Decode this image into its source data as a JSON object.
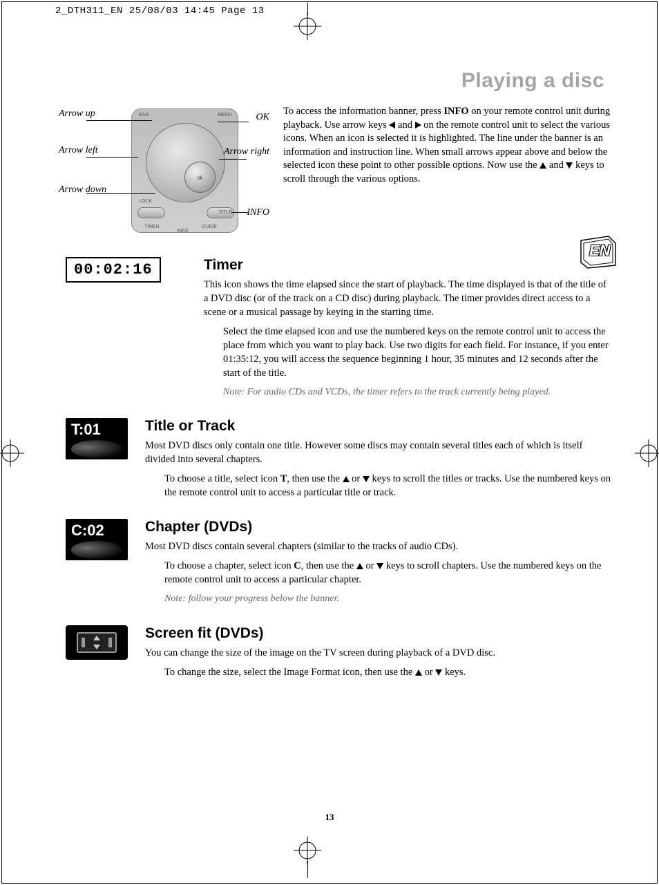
{
  "meta": {
    "header": "2_DTH311_EN  25/08/03  14:45  Page 13",
    "page_number": "13",
    "lang_badge": "EN"
  },
  "chapter_title": "Playing a disc",
  "remote": {
    "arrow_up": "Arrow up",
    "arrow_left": "Arrow left",
    "arrow_down": "Arrow down",
    "arrow_right": "Arrow right",
    "ok": "OK",
    "info": "INFO",
    "ok_btn": "ok",
    "btn_clear": "EAR",
    "btn_menu": "MENU",
    "btn_lock": "LOCK",
    "btn_title": "TITLE",
    "btn_timer": "TIMER",
    "btn_guide": "GUIDE",
    "btn_info": "INFO"
  },
  "intro": {
    "p1a": "To access the information banner, press ",
    "info_bold": "INFO",
    "p1b": " on your remote control unit during playback. Use arrow keys ",
    "p1c": " and ",
    "p1d": " on the remote control unit to select the various icons. When an icon is selected it is highlighted. The line under the banner is an information and instruction line. When small arrows appear above and below the selected icon these point to other possible options. Now use the ",
    "p1e": " and ",
    "p1f": " keys to scroll through the various options."
  },
  "timer": {
    "display": "00:02:16",
    "heading": "Timer",
    "p1": "This icon shows the time elapsed since the start of playback. The time displayed is that of the title of a DVD disc (or of the track on a CD disc) during playback. The timer provides direct access to a scene or a musical passage by keying in the starting time.",
    "p2": "Select the time elapsed icon and use the numbered keys on the remote control unit to access the place from which you want to play back. Use two digits for each field. For instance, if you enter 01:35:12, you will access the sequence beginning 1 hour, 35 minutes and 12 seconds after the start of the title.",
    "note": "Note: For audio CDs and VCDs, the timer refers to the track currently being played."
  },
  "title": {
    "icon_label": "T:01",
    "heading": "Title or Track",
    "p1": "Most DVD discs only contain one title. However some discs may contain several titles each of which is itself divided into several chapters.",
    "p2a": "To choose a title, select icon ",
    "t_bold": "T",
    "p2b": ", then use the ",
    "p2c": " or ",
    "p2d": " keys to scroll the titles or tracks. Use the numbered keys on the remote control unit to access a particular title or track."
  },
  "chapter": {
    "icon_label": "C:02",
    "heading": "Chapter (DVDs)",
    "p1": "Most DVD discs contain several chapters (similar to the tracks of audio CDs).",
    "p2a": "To choose a chapter, select icon ",
    "c_bold": "C",
    "p2b": ", then use the ",
    "p2c": " or ",
    "p2d": " keys to scroll chapters. Use the numbered keys on the remote control unit to access a particular chapter.",
    "note": "Note: follow your progress below the banner."
  },
  "screenfit": {
    "heading": "Screen fit (DVDs)",
    "p1": "You can change the size of the image on the TV screen during playback of a DVD disc.",
    "p2a": "To change the size, select the Image Format icon, then use the ",
    "p2b": " or ",
    "p2c": " keys."
  }
}
